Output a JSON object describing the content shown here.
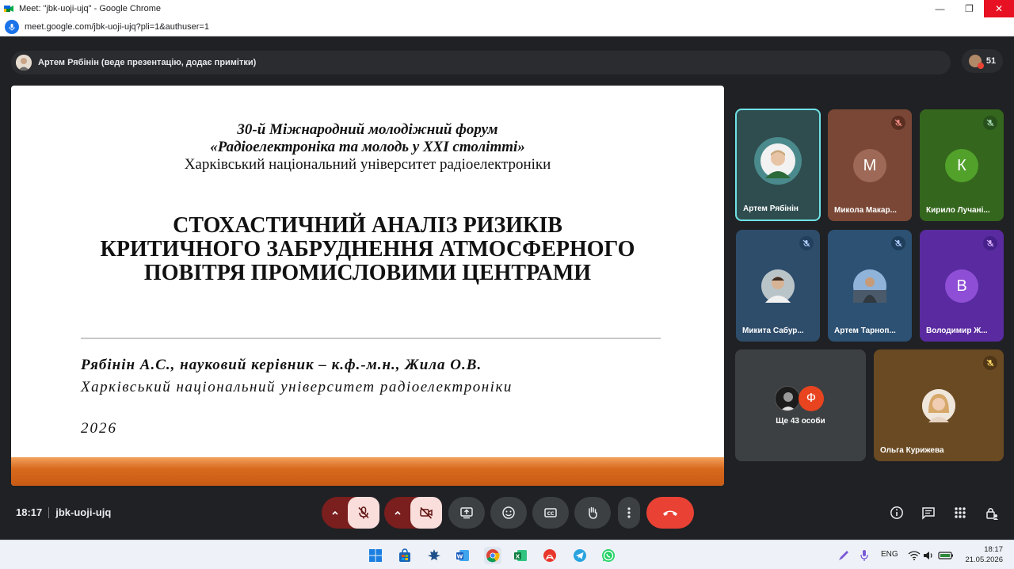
{
  "browser": {
    "window_title": "Meet: \"jbk-uoji-ujq\" - Google Chrome",
    "url": "meet.google.com/jbk-uoji-ujq?pli=1&authuser=1"
  },
  "meet": {
    "presenter_text": "Артем Рябінін (веде презентацію, додає примітки)",
    "participant_count": "51",
    "time": "18:17",
    "meeting_code": "jbk-uoji-ujq"
  },
  "slide": {
    "forum_line1": "30-й Міжнародний молодіжний форум",
    "forum_line2": "«Радіоелектроніка та молодь у XXI столітті»",
    "forum_line3": "Харківський національний університет радіоелектроніки",
    "title_line1": "СТОХАСТИЧНИЙ АНАЛІЗ РИЗИКІВ",
    "title_line2": "КРИТИЧНОГО ЗАБРУДНЕННЯ АТМОСФЕРНОГО",
    "title_line3": "ПОВІТРЯ ПРОМИСЛОВИМИ ЦЕНТРАМИ",
    "authors": "Рябінін А.С., науковий керівник – к.ф.-м.н., Жила О.В.",
    "university": "Харківський національний університет радіоелектроніки",
    "year": "2026"
  },
  "tiles": [
    {
      "name": "Артем Рябінін",
      "muted": false
    },
    {
      "name": "Микола Макар...",
      "initial": "М",
      "muted": true
    },
    {
      "name": "Кирило Лучані...",
      "initial": "К",
      "muted": true
    },
    {
      "name": "Микита Сабур...",
      "muted": true
    },
    {
      "name": "Артем Тарноп...",
      "muted": true
    },
    {
      "name": "Володимир Ж...",
      "initial": "В",
      "muted": true
    },
    {
      "more_text": "Ще 43 особи",
      "initial": "Ф"
    },
    {
      "name": "Ольга Курижева",
      "muted": true
    }
  ],
  "taskbar": {
    "lang": "ENG",
    "clock_time": "18:17",
    "clock_date": "21.05.2026"
  },
  "colors": {
    "meet_bg": "#202124",
    "end_call": "#e94235",
    "active_speaker_border": "#6fe2e6",
    "slide_band": "#c95a14"
  }
}
